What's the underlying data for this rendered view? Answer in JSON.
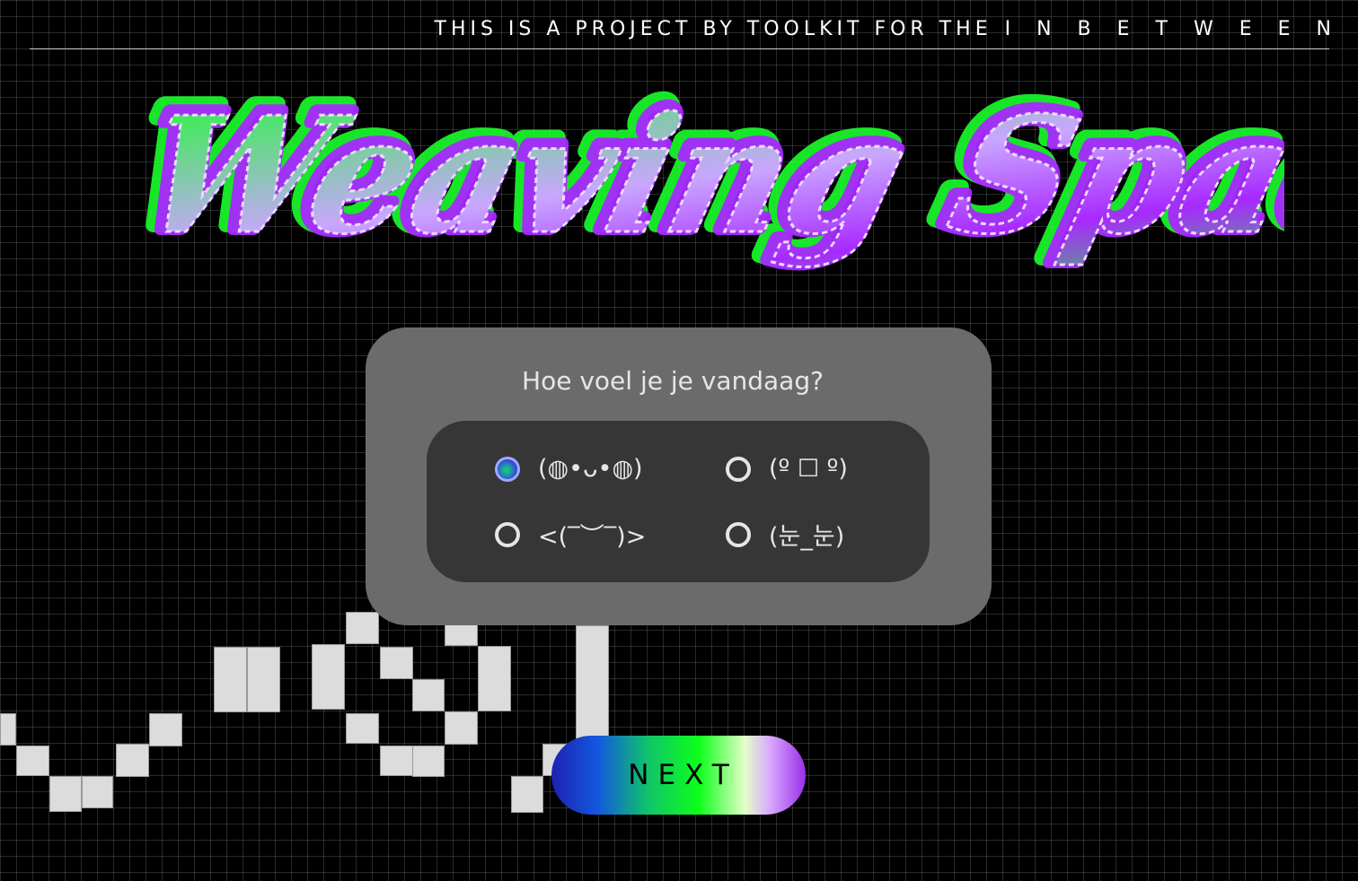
{
  "header": {
    "credit_prefix": "THIS IS A PROJECT BY TOOLKIT FOR THE",
    "credit_suffix": "INBETWEEN"
  },
  "title": {
    "text": "Weaving Spaces"
  },
  "mood_form": {
    "question": "Hoe voel je je vandaag?",
    "options": [
      {
        "label": "(◍•ᴗ•◍)",
        "selected": true
      },
      {
        "label": "(º ☐ º)",
        "selected": false
      },
      {
        "label": "<(‾︶‾)>",
        "selected": false
      },
      {
        "label": "(눈_눈)",
        "selected": false
      }
    ]
  },
  "actions": {
    "next_label": "NEXT"
  },
  "colors": {
    "background": "#000000",
    "card": "#6b6b6b",
    "options_panel": "#363636",
    "title_green": "#19ff2c",
    "title_purple": "#a829ff",
    "button_gradient_start": "#1e22b0",
    "button_gradient_end": "#9a2ee8"
  }
}
